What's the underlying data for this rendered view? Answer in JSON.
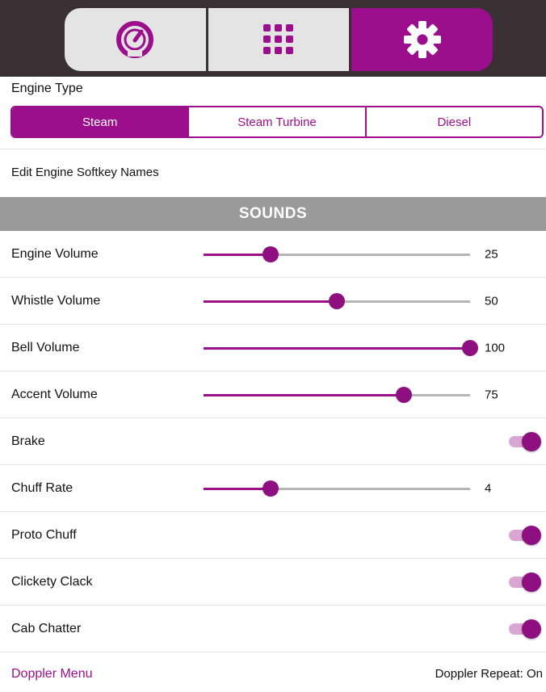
{
  "top_tabs": [
    {
      "icon": "speedometer-icon",
      "active": false
    },
    {
      "icon": "grid-icon",
      "active": false
    },
    {
      "icon": "gear-icon",
      "active": true
    }
  ],
  "engine_type": {
    "label": "Engine Type",
    "options": [
      "Steam",
      "Steam Turbine",
      "Diesel"
    ],
    "selected": "Steam"
  },
  "edit_softkeys_label": "Edit Engine Softkey Names",
  "sounds": {
    "header": "SOUNDS",
    "rows": [
      {
        "label": "Engine Volume",
        "type": "slider",
        "value_text": "25",
        "level": 0.25
      },
      {
        "label": "Whistle Volume",
        "type": "slider",
        "value_text": "50",
        "level": 0.5
      },
      {
        "label": "Bell Volume",
        "type": "slider",
        "value_text": "100",
        "level": 1.0
      },
      {
        "label": "Accent Volume",
        "type": "slider",
        "value_text": "75",
        "level": 0.75
      },
      {
        "label": "Brake",
        "type": "toggle",
        "on": true
      },
      {
        "label": "Chuff Rate",
        "type": "slider",
        "value_text": "4",
        "level": 0.25
      },
      {
        "label": "Proto Chuff",
        "type": "toggle",
        "on": true
      },
      {
        "label": "Clickety Clack",
        "type": "toggle",
        "on": true
      },
      {
        "label": "Cab Chatter",
        "type": "toggle",
        "on": true
      }
    ]
  },
  "footer": {
    "doppler_menu": "Doppler Menu",
    "doppler_repeat": "Doppler Repeat: On"
  },
  "colors": {
    "accent": "#9b0f8c",
    "topbar": "#3a2f33",
    "section_header": "#9a9a9a"
  }
}
